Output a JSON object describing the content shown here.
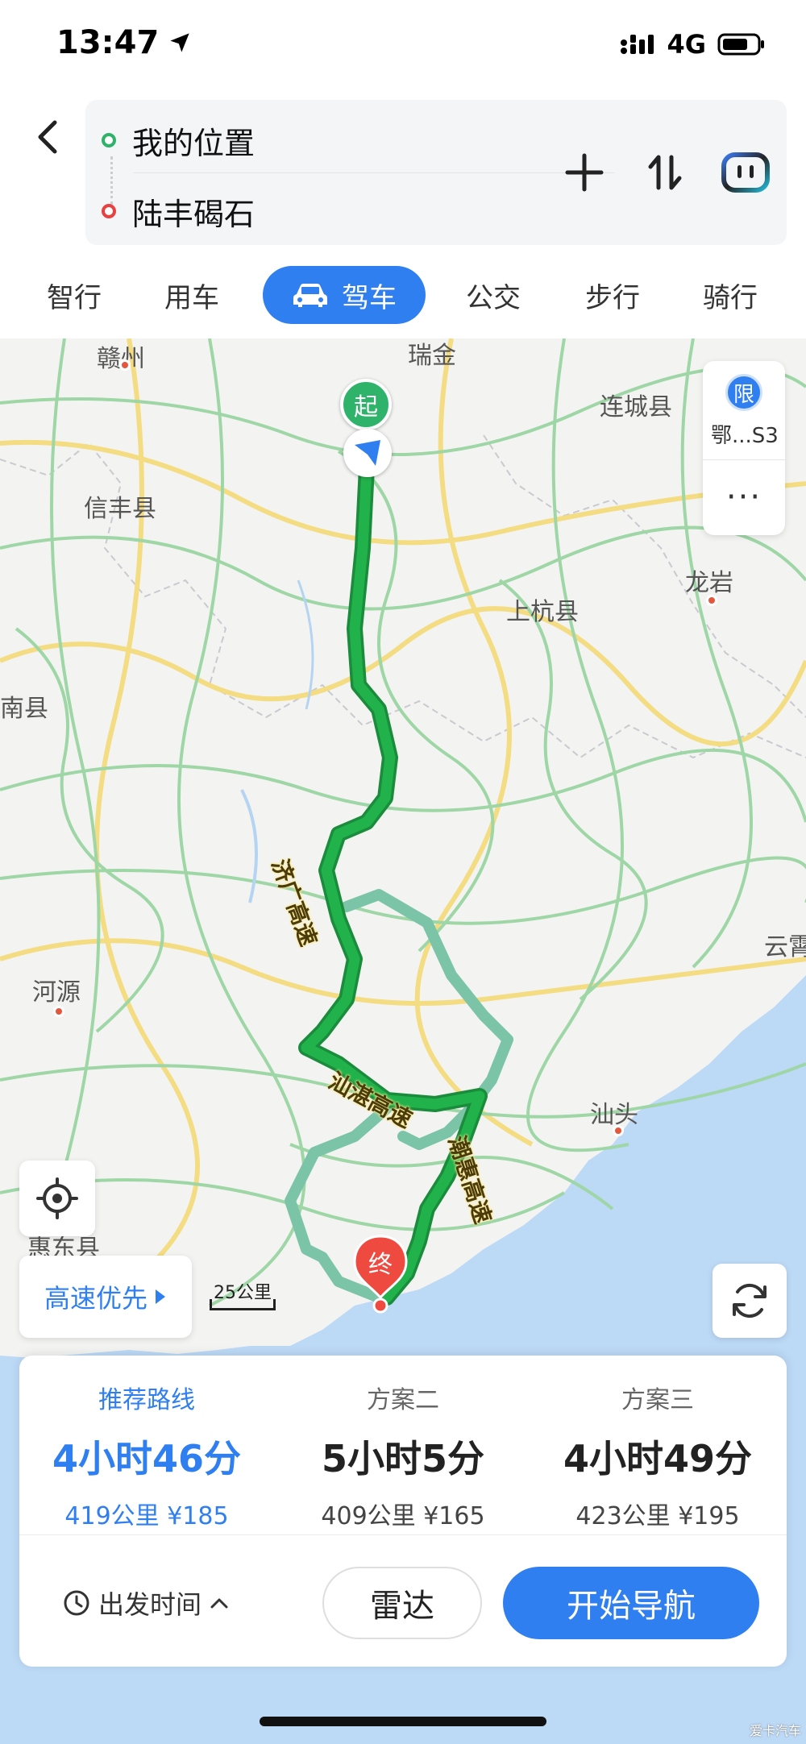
{
  "status_bar": {
    "time": "13:47",
    "network": "4G",
    "icons": [
      "location-arrow-icon",
      "signal-icon",
      "battery-icon"
    ]
  },
  "route": {
    "from": "我的位置",
    "to": "陆丰碣石",
    "actions": [
      "add-icon",
      "swap-icon",
      "assistant-icon"
    ]
  },
  "tabs": [
    "智行",
    "用车",
    "驾车",
    "公交",
    "步行",
    "骑行"
  ],
  "active_tab": "驾车",
  "map": {
    "places": {
      "ganzhou": "赣州",
      "ruijin": "瑞金",
      "liancheng": "连城县",
      "xinfeng": "信丰县",
      "longyan": "龙岩",
      "shanghang": "上杭县",
      "nanxian": "南县",
      "heyuan": "河源",
      "yunxiao": "云霄",
      "shantou": "汕头",
      "huidong": "惠东县"
    },
    "roads": {
      "jiguang": "济广高速",
      "shanzhan": "汕湛高速",
      "chaohui": "潮惠高速"
    },
    "start_marker": "起",
    "end_marker": "终",
    "restriction": {
      "badge": "限",
      "text": "鄂...S3"
    },
    "more": "···",
    "highway_pref": "高速优先",
    "scale": "25公里",
    "colors": {
      "route_main": "#1faa4a",
      "route_alt": "#7cc4a8",
      "water": "#bcd9f6",
      "land": "#f3f4f2"
    }
  },
  "plans": [
    {
      "name": "推荐路线",
      "time": "4小时46分",
      "meta": "419公里 ¥185"
    },
    {
      "name": "方案二",
      "time": "5小时5分",
      "meta": "409公里 ¥165"
    },
    {
      "name": "方案三",
      "time": "4小时49分",
      "meta": "423公里 ¥195"
    }
  ],
  "controls": {
    "depart_time": "出发时间",
    "radar": "雷达",
    "start_nav": "开始导航"
  },
  "watermark": "爱卡汽车"
}
